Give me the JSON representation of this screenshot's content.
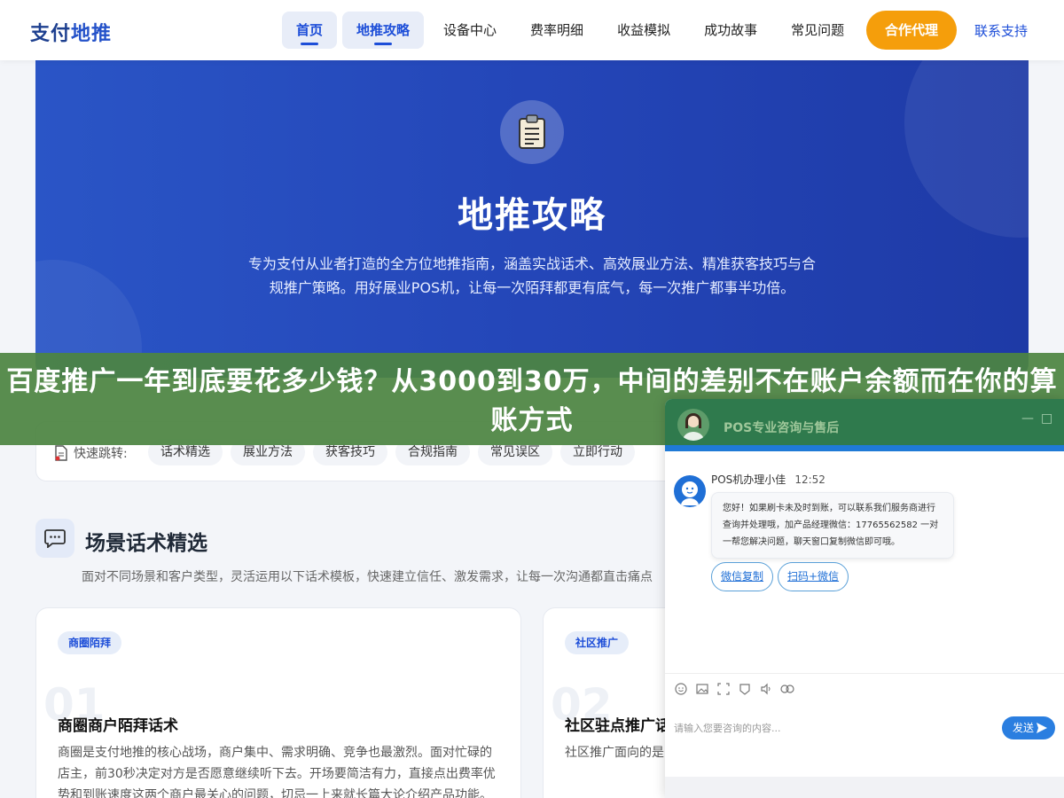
{
  "brand": {
    "part1": "支付",
    "part2": "地推"
  },
  "nav": {
    "items": [
      "首页",
      "地推攻略",
      "设备中心",
      "费率明细",
      "收益模拟",
      "成功故事",
      "常见问题"
    ],
    "cta": "合作代理",
    "contact": "联系支持"
  },
  "hero": {
    "icon": "clipboard-icon",
    "title": "地推攻略",
    "description": "专为支付从业者打造的全方位地推指南，涵盖实战话术、高效展业方法、精准获客技巧与合规推广策略。用好展业POS机，让每一次陌拜都更有底气，每一次推广都事半功倍。"
  },
  "quick_jump": {
    "label": "快速跳转:",
    "chips": [
      "话术精选",
      "展业方法",
      "获客技巧",
      "合规指南",
      "常见误区",
      "立即行动"
    ]
  },
  "section": {
    "title": "场景话术精选",
    "description": "面对不同场景和客户类型，灵活运用以下话术模板，快速建立信任、激发需求，让每一次沟通都直击痛点"
  },
  "cards": [
    {
      "tag": "商圈陌拜",
      "number": "01",
      "title": "商圈商户陌拜话术",
      "text": "商圈是支付地推的核心战场，商户集中、需求明确、竞争也最激烈。面对忙碌的店主，前30秒决定对方是否愿意继续听下去。开场要简洁有力，直接点出费率优势和到账速度这两个商户最关心的问题，切忌一上来就长篇大论介绍产品功能。"
    },
    {
      "tag": "社区推广",
      "number": "02",
      "title": "社区驻点推广话术",
      "text": "社区推广面向的是区驻点时，亲和力——这台POS机安"
    }
  ],
  "banner": {
    "text": "百度推广一年到底要花多少钱？从3000到30万，中间的差别不在账户余额而在你的算账方式"
  },
  "chat": {
    "title": "POS专业咨询与售后",
    "minimize": "—",
    "maximize": "□",
    "agent_name": "POS机办理小佳",
    "time": "12:52",
    "message": "您好！如果刷卡未及时到账，可以联系我们服务商进行查询并处理哦，加产品经理微信：17765562582 一对一帮您解决问题，聊天窗口复制微信即可哦。",
    "buttons": [
      "微信复制",
      "扫码+微信"
    ],
    "tools": [
      "emoji-icon",
      "image-icon",
      "screenshot-icon",
      "rate-icon",
      "voice-icon",
      "link-icon"
    ],
    "input_placeholder": "请输入您要咨询的内容...",
    "send_label": "发送"
  }
}
